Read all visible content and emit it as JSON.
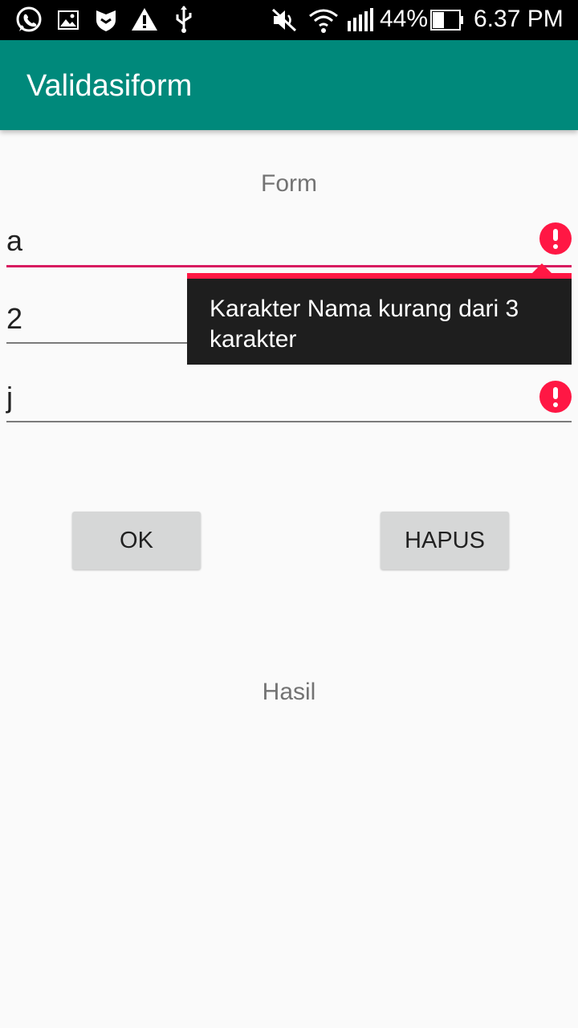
{
  "status_bar": {
    "battery": "44%",
    "time": "6.37 PM",
    "icons": [
      "whatsapp-icon",
      "image-icon",
      "shield-icon",
      "warning-icon",
      "usb-icon",
      "mute-icon",
      "wifi-icon",
      "signal-icon",
      "battery-icon"
    ]
  },
  "app_bar": {
    "title": "Validasiform"
  },
  "form": {
    "title": "Form",
    "fields": [
      {
        "value": "a",
        "error": true
      },
      {
        "value": "2",
        "error": true
      },
      {
        "value": "j",
        "error": true
      }
    ],
    "error_popup": "Karakter Nama kurang dari 3 karakter"
  },
  "buttons": {
    "ok": "OK",
    "hapus": "HAPUS"
  },
  "result": {
    "label": "Hasil"
  },
  "colors": {
    "primary": "#00897b",
    "accent": "#d81b60",
    "error": "#ff1744"
  }
}
